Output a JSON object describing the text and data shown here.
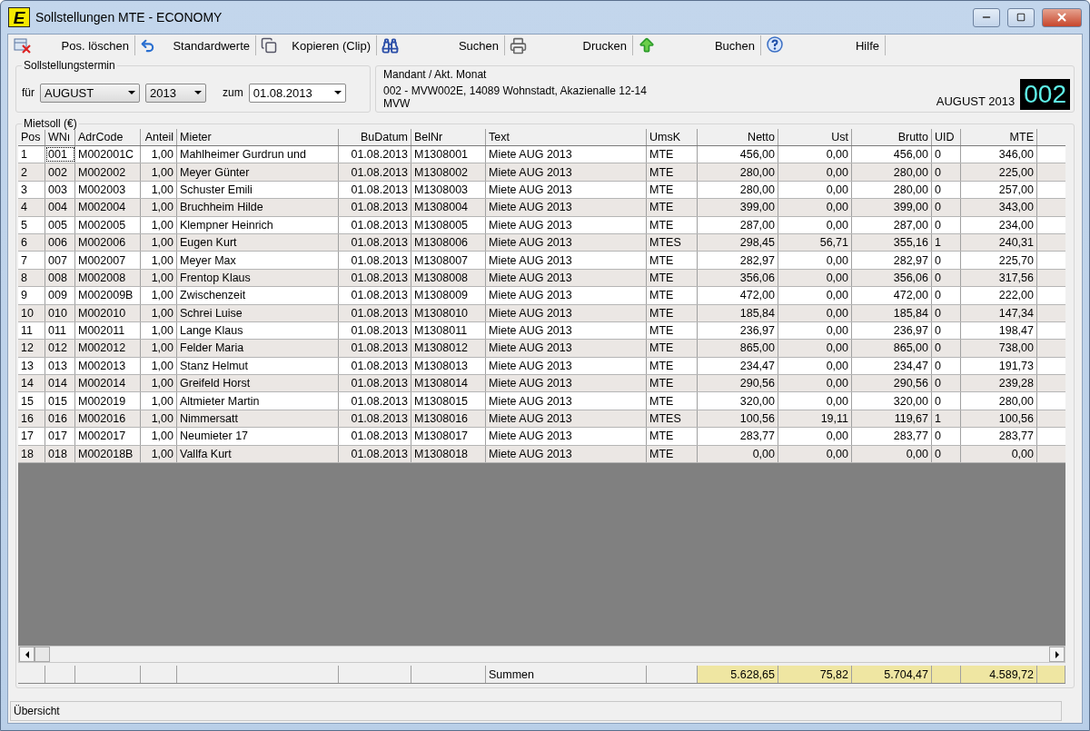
{
  "window": {
    "title": "Sollstellungen MTE - ECONOMY",
    "logo": "E"
  },
  "toolbar": [
    {
      "kind": "delete",
      "label": "Pos. löschen"
    },
    {
      "kind": "undo",
      "label": "Standardwerte"
    },
    {
      "kind": "copy",
      "label": "Kopieren (Clip)"
    },
    {
      "kind": "search",
      "label": "Suchen"
    },
    {
      "kind": "print",
      "label": "Drucken"
    },
    {
      "kind": "post",
      "label": "Buchen"
    },
    {
      "kind": "help",
      "label": "Hilfe"
    }
  ],
  "termin": {
    "title": "Sollstellungstermin",
    "for_label": "für",
    "month": "AUGUST",
    "year": "2013",
    "date_label": "zum",
    "date": "01.08.2013"
  },
  "mandant": {
    "title": "Mandant / Akt. Monat",
    "line1": "002 - MVW002E, 14089 Wohnstadt, Akazienalle 12-14",
    "line2": "MVW",
    "month": "AUGUST 2013",
    "number": "002"
  },
  "table": {
    "title": "Mietsoll (€)",
    "columns": [
      "Pos",
      "WNı",
      "AdrCode",
      "Anteil",
      "Mieter",
      "BuDatum",
      "BelNr",
      "Text",
      "UmsK",
      "Netto",
      "Ust",
      "Brutto",
      "UID",
      "MTE"
    ],
    "rows": [
      {
        "focused": true,
        "cells": [
          "1",
          "001",
          "M002001C",
          "1,00",
          "Mahlheimer Gurdrun und",
          "01.08.2013",
          "M1308001",
          "Miete AUG 2013",
          "MTE",
          "456,00",
          "0,00",
          "456,00",
          "0",
          "346,00"
        ]
      },
      {
        "focused": false,
        "cells": [
          "2",
          "002",
          "M002002",
          "1,00",
          "Meyer Günter",
          "01.08.2013",
          "M1308002",
          "Miete AUG 2013",
          "MTE",
          "280,00",
          "0,00",
          "280,00",
          "0",
          "225,00"
        ]
      },
      {
        "focused": false,
        "cells": [
          "3",
          "003",
          "M002003",
          "1,00",
          "Schuster Emili",
          "01.08.2013",
          "M1308003",
          "Miete AUG 2013",
          "MTE",
          "280,00",
          "0,00",
          "280,00",
          "0",
          "257,00"
        ]
      },
      {
        "focused": false,
        "cells": [
          "4",
          "004",
          "M002004",
          "1,00",
          "Bruchheim Hilde",
          "01.08.2013",
          "M1308004",
          "Miete AUG 2013",
          "MTE",
          "399,00",
          "0,00",
          "399,00",
          "0",
          "343,00"
        ]
      },
      {
        "focused": false,
        "cells": [
          "5",
          "005",
          "M002005",
          "1,00",
          "Klempner Heinrich",
          "01.08.2013",
          "M1308005",
          "Miete AUG 2013",
          "MTE",
          "287,00",
          "0,00",
          "287,00",
          "0",
          "234,00"
        ]
      },
      {
        "focused": false,
        "cells": [
          "6",
          "006",
          "M002006",
          "1,00",
          "Eugen Kurt",
          "01.08.2013",
          "M1308006",
          "Miete AUG 2013",
          "MTES",
          "298,45",
          "56,71",
          "355,16",
          "1",
          "240,31"
        ]
      },
      {
        "focused": false,
        "cells": [
          "7",
          "007",
          "M002007",
          "1,00",
          "Meyer Max",
          "01.08.2013",
          "M1308007",
          "Miete AUG 2013",
          "MTE",
          "282,97",
          "0,00",
          "282,97",
          "0",
          "225,70"
        ]
      },
      {
        "focused": false,
        "cells": [
          "8",
          "008",
          "M002008",
          "1,00",
          "Frentop Klaus",
          "01.08.2013",
          "M1308008",
          "Miete AUG 2013",
          "MTE",
          "356,06",
          "0,00",
          "356,06",
          "0",
          "317,56"
        ]
      },
      {
        "focused": false,
        "cells": [
          "9",
          "009",
          "M002009B",
          "1,00",
          "Zwischenzeit",
          "01.08.2013",
          "M1308009",
          "Miete AUG 2013",
          "MTE",
          "472,00",
          "0,00",
          "472,00",
          "0",
          "222,00"
        ]
      },
      {
        "focused": false,
        "cells": [
          "10",
          "010",
          "M002010",
          "1,00",
          "Schrei Luise",
          "01.08.2013",
          "M1308010",
          "Miete AUG 2013",
          "MTE",
          "185,84",
          "0,00",
          "185,84",
          "0",
          "147,34"
        ]
      },
      {
        "focused": false,
        "cells": [
          "11",
          "011",
          "M002011",
          "1,00",
          "Lange Klaus",
          "01.08.2013",
          "M1308011",
          "Miete AUG 2013",
          "MTE",
          "236,97",
          "0,00",
          "236,97",
          "0",
          "198,47"
        ]
      },
      {
        "focused": false,
        "cells": [
          "12",
          "012",
          "M002012",
          "1,00",
          "Felder Maria",
          "01.08.2013",
          "M1308012",
          "Miete AUG 2013",
          "MTE",
          "865,00",
          "0,00",
          "865,00",
          "0",
          "738,00"
        ]
      },
      {
        "focused": false,
        "cells": [
          "13",
          "013",
          "M002013",
          "1,00",
          "Stanz Helmut",
          "01.08.2013",
          "M1308013",
          "Miete AUG 2013",
          "MTE",
          "234,47",
          "0,00",
          "234,47",
          "0",
          "191,73"
        ]
      },
      {
        "focused": false,
        "cells": [
          "14",
          "014",
          "M002014",
          "1,00",
          "Greifeld Horst",
          "01.08.2013",
          "M1308014",
          "Miete AUG 2013",
          "MTE",
          "290,56",
          "0,00",
          "290,56",
          "0",
          "239,28"
        ]
      },
      {
        "focused": false,
        "cells": [
          "15",
          "015",
          "M002019",
          "1,00",
          "Altmieter Martin",
          "01.08.2013",
          "M1308015",
          "Miete AUG 2013",
          "MTE",
          "320,00",
          "0,00",
          "320,00",
          "0",
          "280,00"
        ]
      },
      {
        "focused": false,
        "cells": [
          "16",
          "016",
          "M002016",
          "1,00",
          "Nimmersatt",
          "01.08.2013",
          "M1308016",
          "Miete AUG 2013",
          "MTES",
          "100,56",
          "19,11",
          "119,67",
          "1",
          "100,56"
        ]
      },
      {
        "focused": false,
        "cells": [
          "17",
          "017",
          "M002017",
          "1,00",
          "Neumieter 17",
          "01.08.2013",
          "M1308017",
          "Miete AUG 2013",
          "MTE",
          "283,77",
          "0,00",
          "283,77",
          "0",
          "283,77"
        ]
      },
      {
        "focused": false,
        "cells": [
          "18",
          "018",
          "M002018B",
          "1,00",
          "Vallfa Kurt",
          "01.08.2013",
          "M1308018",
          "Miete AUG 2013",
          "MTE",
          "0,00",
          "0,00",
          "0,00",
          "0",
          "0,00"
        ]
      }
    ],
    "summary": {
      "label": "Summen",
      "totals": [
        "5.628,65",
        "75,82",
        "5.704,47",
        "4.589,72"
      ]
    }
  },
  "status_bar": {
    "text": "Übersicht"
  }
}
